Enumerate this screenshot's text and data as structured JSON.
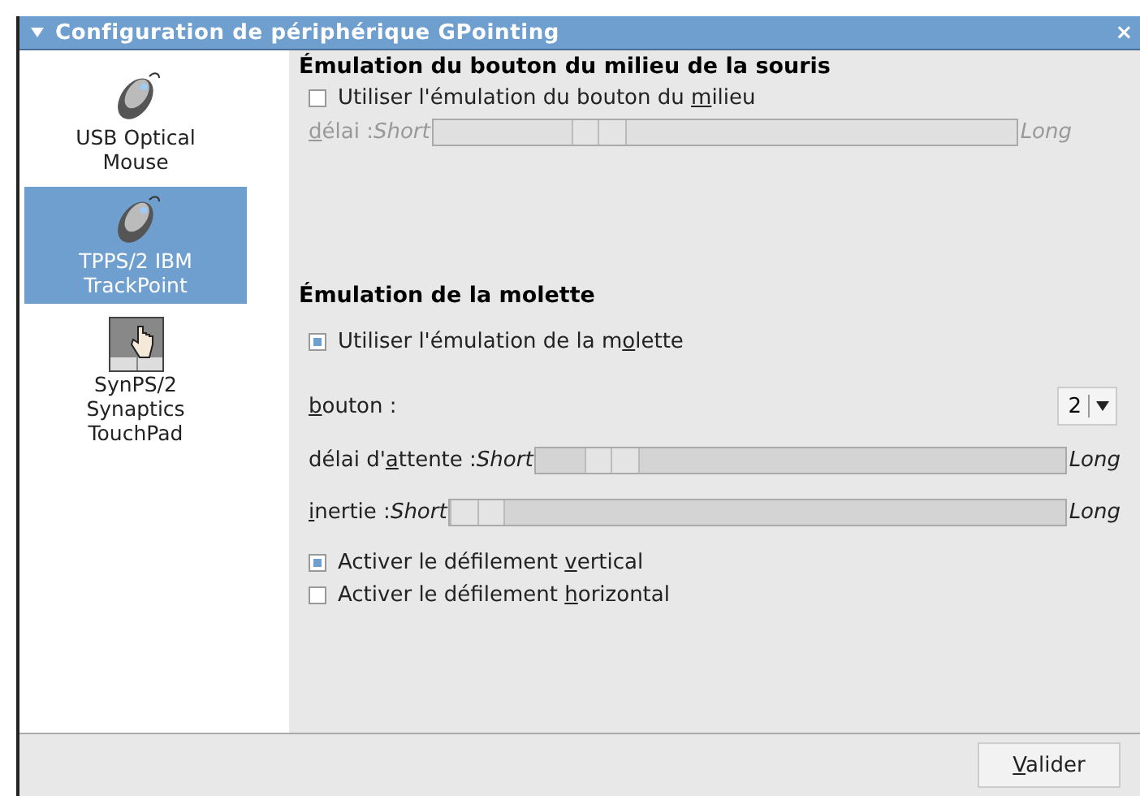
{
  "window": {
    "title": "Configuration de périphérique GPointing",
    "close": "×"
  },
  "sidebar": {
    "items": [
      {
        "label": "USB Optical Mouse",
        "kind": "mouse",
        "selected": false
      },
      {
        "label": "TPPS/2 IBM TrackPoint",
        "kind": "mouse",
        "selected": true
      },
      {
        "label": "SynPS/2 Synaptics TouchPad",
        "kind": "touchpad",
        "selected": false
      }
    ]
  },
  "middle_button": {
    "heading": "Émulation du bouton du milieu de la souris",
    "checkbox": {
      "label": {
        "before": "Utiliser l'émulation du bouton du ",
        "key": "m",
        "after": "ilieu"
      },
      "checked": false
    },
    "delay": {
      "label": {
        "key": "d",
        "after": "élai :"
      },
      "min": "Short",
      "max": "Long",
      "level": 0.26,
      "disabled": true
    }
  },
  "wheel": {
    "heading": "Émulation de la molette",
    "checkbox": {
      "label": {
        "before": "Utiliser l'émulation de la m",
        "key": "o",
        "after": "lette"
      },
      "checked": true
    },
    "button": {
      "label": {
        "key": "b",
        "after": "outon :"
      },
      "value": "2"
    },
    "sliders": [
      {
        "label": {
          "before": "délai d'",
          "key": "a",
          "after": "ttente :"
        },
        "min": "Short",
        "max": "Long",
        "level": 0.1,
        "disabled": false
      },
      {
        "label": {
          "key": "i",
          "after": "nertie :"
        },
        "min": "Short",
        "max": "Long",
        "level": 0,
        "disabled": false
      }
    ],
    "options": [
      {
        "label": {
          "before": "Activer le défilement ",
          "key": "v",
          "after": "ertical"
        },
        "checked": true
      },
      {
        "label": {
          "before": "Activer le défilement ",
          "key": "h",
          "after": "orizontal"
        },
        "checked": false
      }
    ]
  },
  "buttons": [
    {
      "label": {
        "key": "V",
        "after": "alider"
      }
    }
  ]
}
